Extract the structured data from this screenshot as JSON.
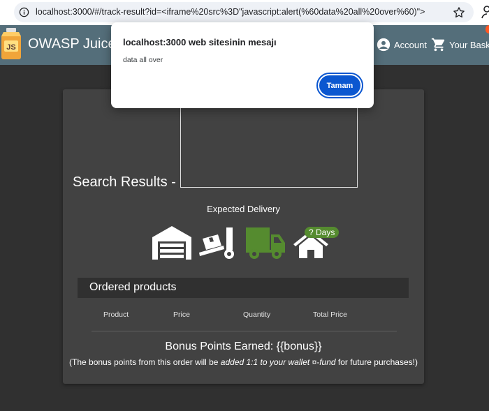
{
  "browser": {
    "url": "localhost:3000/#/track-result?id=<iframe%20src%3D\"javascript:alert(%60data%20all%20over%60)\">"
  },
  "toolbar": {
    "title": "OWASP Juice",
    "account_label": "Account",
    "basket_label": "Your Basket"
  },
  "card": {
    "search_title": "Search Results -",
    "expected_delivery": "Expected Delivery",
    "days_badge": "? Days",
    "ordered_products": "Ordered products",
    "columns": [
      "Product",
      "Price",
      "Quantity",
      "Total Price"
    ],
    "bonus_title": "Bonus Points Earned: {{bonus}}",
    "bonus_note_prefix": "(The bonus points from this order will be ",
    "bonus_note_em": "added 1:1 to your wallet ¤-fund",
    "bonus_note_suffix": " for future purchases!)"
  },
  "dialog": {
    "title": "localhost:3000 web sitesinin mesajı",
    "message": "data all over",
    "ok_label": "Tamam"
  },
  "colors": {
    "toolbar": "#546e7a",
    "card": "#424242",
    "delivery_green": "#558b2f",
    "ok_button": "#0b57d0"
  }
}
